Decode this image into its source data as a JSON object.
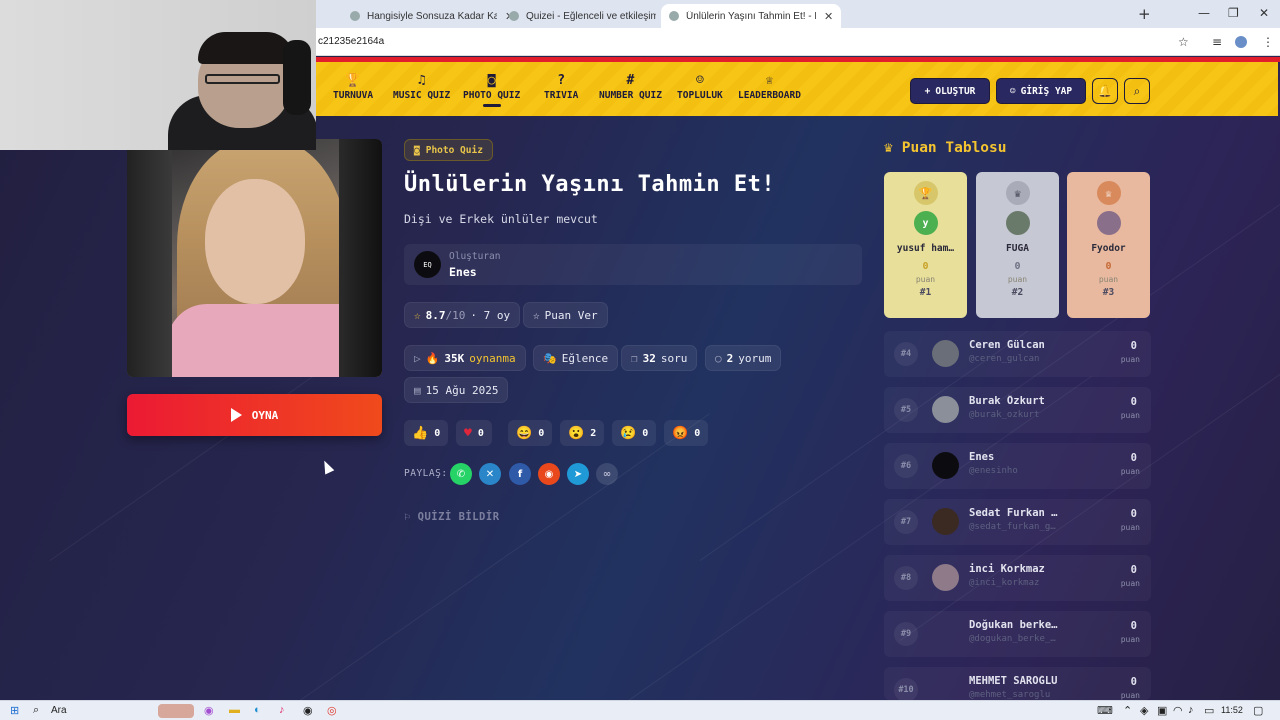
{
  "browser": {
    "tabs": [
      {
        "title": "Hangisiyle Sonsuza Kadar Kah",
        "active": false
      },
      {
        "title": "Quizei - Eğlenceli ve etkileşimi",
        "active": false
      },
      {
        "title": "Ünlülerin Yaşını Tahmin Et! - Ph",
        "active": true
      }
    ],
    "new_tab": "+",
    "url": "c21235e2164a"
  },
  "header": {
    "nav": [
      {
        "label": "TURNUVA",
        "icon": "trophy-icon",
        "glyph": "🏆"
      },
      {
        "label": "MUSIC QUIZ",
        "icon": "music-icon",
        "glyph": "♫"
      },
      {
        "label": "PHOTO QUIZ",
        "icon": "camera-icon",
        "glyph": "◙"
      },
      {
        "label": "TRIVIA",
        "icon": "question-icon",
        "glyph": "?"
      },
      {
        "label": "NUMBER QUIZ",
        "icon": "hash-icon",
        "glyph": "#"
      },
      {
        "label": "TOPLULUK",
        "icon": "users-icon",
        "glyph": "☺"
      },
      {
        "label": "LEADERBOARD",
        "icon": "award-icon",
        "glyph": "♕"
      }
    ],
    "create_label": "OLUŞTUR",
    "login_label": "GİRİŞ YAP"
  },
  "quiz": {
    "category": "Photo Quiz",
    "title": "Ünlülerin Yaşını Tahmin Et!",
    "subtitle": "Dişi ve Erkek ünlüler mevcut",
    "creator_label": "Oluşturan",
    "creator_name": "Enes",
    "creator_avatar_text": "EQ",
    "rating": "8.7",
    "rating_max": "/10",
    "votes": "· 7 oy",
    "rate_label": "Puan Ver",
    "plays_count": "35K",
    "plays_label": "oynanma",
    "genre": "Eğlence",
    "questions_count": "32",
    "questions_label": "soru",
    "comments_count": "2",
    "comments_label": "yorum",
    "date": "15 Ağu 2025",
    "play_label": "OYNA",
    "reactions": [
      {
        "emoji": "👍",
        "count": "0"
      },
      {
        "emoji": "♥",
        "count": "0"
      },
      {
        "emoji": "😄",
        "count": "0"
      },
      {
        "emoji": "😮",
        "count": "2"
      },
      {
        "emoji": "😢",
        "count": "0"
      },
      {
        "emoji": "😡",
        "count": "0"
      }
    ],
    "share_label": "PAYLAŞ:",
    "report_label": "QUİZİ BİLDİR"
  },
  "leaderboard": {
    "title": "Puan Tablosu",
    "points_unit": "puan",
    "podium": [
      {
        "name": "yusuf ham…",
        "score": "0",
        "rank": "#1",
        "avatar_letter": "y",
        "bg": "#e7df9a",
        "medal": "#c9a227",
        "score_color": "#c9a227"
      },
      {
        "name": "FUGA",
        "score": "0",
        "rank": "#2",
        "avatar_letter": "",
        "bg": "#c6c8d4",
        "medal": "#8c8fa0",
        "score_color": "#6f7284"
      },
      {
        "name": "Fyodor",
        "score": "0",
        "rank": "#3",
        "avatar_letter": "",
        "bg": "#e8b99f",
        "medal": "#c66a35",
        "score_color": "#c66a35"
      }
    ],
    "rows": [
      {
        "rank": "#4",
        "name": "Ceren Gülcan",
        "user": "@ceren_gulcan",
        "score": "0",
        "av": "#6a6e78"
      },
      {
        "rank": "#5",
        "name": "Burak Özkurt",
        "user": "@burak_ozkurt",
        "score": "0",
        "av": "#8a8f99"
      },
      {
        "rank": "#6",
        "name": "Enes",
        "user": "@enesinho",
        "score": "0",
        "av": "#0c0c10"
      },
      {
        "rank": "#7",
        "name": "Sedat Furkan …",
        "user": "@sedat_furkan_g…",
        "score": "0",
        "av": "#3b2a22"
      },
      {
        "rank": "#8",
        "name": "inci Korkmaz",
        "user": "@inci_korkmaz",
        "score": "0",
        "av": "#8e7a88"
      },
      {
        "rank": "#9",
        "name": "Doğukan berke…",
        "user": "@dogukan_berke_…",
        "score": "0",
        "av": "transparent"
      },
      {
        "rank": "#10",
        "name": "MEHMET SAROĞLU",
        "user": "@mehmet_saroglu",
        "score": "0",
        "av": "transparent"
      }
    ]
  },
  "taskbar": {
    "search_label": "Ara",
    "time": "11:52"
  }
}
